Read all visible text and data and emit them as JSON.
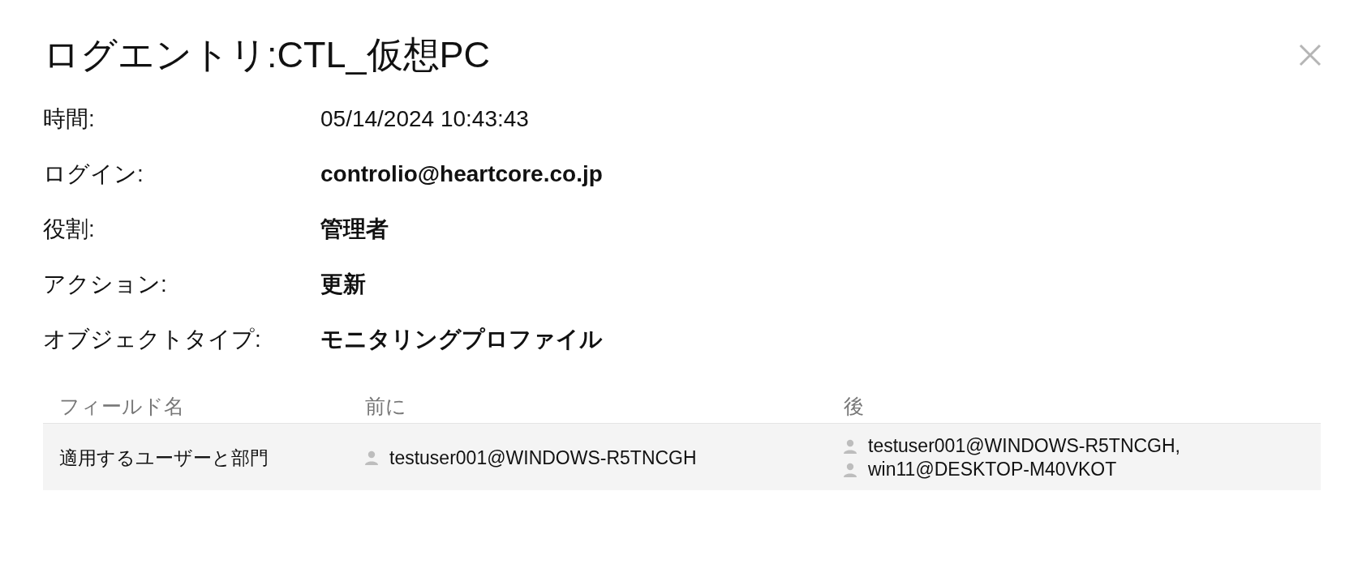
{
  "dialog": {
    "title": "ログエントリ:CTL_仮想PC"
  },
  "details": [
    {
      "label": "時間:",
      "value": "05/14/2024 10:43:43",
      "bold": false
    },
    {
      "label": "ログイン:",
      "value": "controlio@heartcore.co.jp",
      "bold": true
    },
    {
      "label": "役割:",
      "value": "管理者",
      "bold": true
    },
    {
      "label": "アクション:",
      "value": "更新",
      "bold": true
    },
    {
      "label": "オブジェクトタイプ:",
      "value": "モニタリングプロファイル",
      "bold": true
    }
  ],
  "table": {
    "columns": [
      "フィールド名",
      "前に",
      "後"
    ],
    "rows": [
      {
        "field": "適用するユーザーと部門",
        "before": [
          "testuser001@WINDOWS-R5TNCGH"
        ],
        "after": [
          "testuser001@WINDOWS-R5TNCGH,",
          "win11@DESKTOP-M40VKOT"
        ]
      }
    ]
  }
}
